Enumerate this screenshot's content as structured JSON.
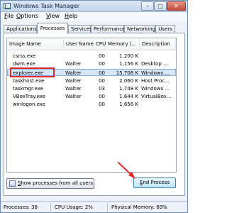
{
  "window": {
    "title": "Windows Task Manager"
  },
  "title_buttons": {
    "minimize": "–",
    "maximize": "□",
    "close": "✕"
  },
  "menu": [
    {
      "mnemonic": "F",
      "rest": "ile"
    },
    {
      "mnemonic": "O",
      "rest": "ptions"
    },
    {
      "mnemonic": "V",
      "rest": "iew"
    },
    {
      "mnemonic": "H",
      "rest": "elp"
    }
  ],
  "tabs": [
    "Applications",
    "Processes",
    "Services",
    "Performance",
    "Networking",
    "Users"
  ],
  "active_tab": "Processes",
  "table": {
    "columns": [
      "Image Name",
      "User Name",
      "CPU",
      "Memory (...",
      "Description"
    ],
    "rows": [
      {
        "image": "csrss.exe",
        "user": "",
        "cpu": "00",
        "memory": "1,200 K",
        "description": ""
      },
      {
        "image": "dwm.exe",
        "user": "Walter",
        "cpu": "00",
        "memory": "1,156 K",
        "description": "Desktop ..."
      },
      {
        "image": "explorer.exe",
        "user": "Walter",
        "cpu": "00",
        "memory": "15,708 K",
        "description": "Windows ..."
      },
      {
        "image": "taskhost.exe",
        "user": "Walter",
        "cpu": "00",
        "memory": "2,060 K",
        "description": "Host Proc..."
      },
      {
        "image": "taskmgr.exe",
        "user": "Walter",
        "cpu": "03",
        "memory": "1,748 K",
        "description": "Windows ..."
      },
      {
        "image": "VBoxTray.exe",
        "user": "Walter",
        "cpu": "00",
        "memory": "1,644 K",
        "description": "VirtualBox..."
      },
      {
        "image": "winlogon.exe",
        "user": "",
        "cpu": "00",
        "memory": "1,656 K",
        "description": ""
      }
    ],
    "selected_row": "explorer.exe"
  },
  "buttons": {
    "show_all": {
      "mnemonic": "S",
      "rest": "how processes from all users"
    },
    "end_process": {
      "mnemonic": "E",
      "rest": "nd Process"
    }
  },
  "status": {
    "processes": "Processes: 38",
    "cpu": "CPU Usage: 2%",
    "memory": "Physical Memory: 89%"
  },
  "colors": {
    "annotation": "#e0282c",
    "selection": "#d7e7f8"
  }
}
